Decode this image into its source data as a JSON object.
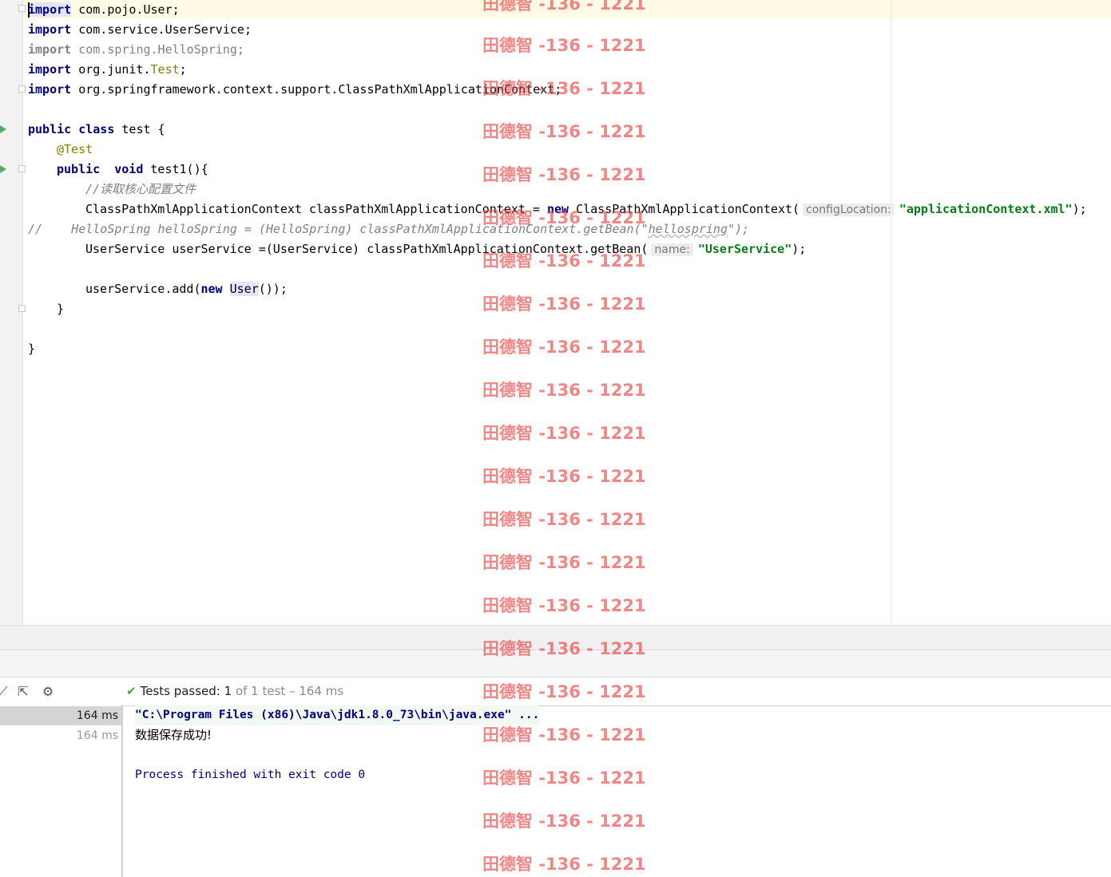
{
  "editor": {
    "imports": [
      {
        "keyword": "import",
        "path": "com.pojo.User",
        "suffix": ";"
      },
      {
        "keyword": "import",
        "path": "com.service.UserService",
        "suffix": ";"
      },
      {
        "keyword": "import",
        "path": "com.spring.HelloSpring",
        "suffix": ";"
      },
      {
        "keyword": "import",
        "path_a": "org.junit.",
        "path_b": "Test",
        "suffix": ";"
      },
      {
        "keyword": "import",
        "path": "org.springframework.context.support.ClassPathXmlApplicationContext",
        "suffix": ";"
      }
    ],
    "class_decl": {
      "kw1": "public",
      "kw2": "class",
      "name": "test {"
    },
    "annotation": "@Test",
    "method_decl": {
      "kw1": "public",
      "kw2": "void",
      "name": "test1(){"
    },
    "comment": "//读取核心配置文件",
    "line_ctx": {
      "a": "ClassPathXmlApplicationContext classPathXmlApplicationContext = ",
      "kw": "new",
      "b": " ClassPathXmlApplicationContext(",
      "hint": "configLocation:",
      "str": "\"applicationContext.xml\"",
      "c": ");"
    },
    "line_commented": {
      "prefix": "//",
      "a": "HelloSpring helloSpring = (HelloSpring) classPathXmlApplicationContext.getBean(\"",
      "b": "hellospring",
      "c": "\");"
    },
    "line_getbean": {
      "a": "UserService userService =(UserService) classPathXmlApplicationContext.getBean(",
      "hint": "name:",
      "str": "\"UserService\"",
      "c": ");"
    },
    "line_add": {
      "a": "userService.add(",
      "kw": "new",
      "sp": " ",
      "b": "User",
      "c": "());"
    },
    "close_method": "}",
    "close_class": "}"
  },
  "run_panel": {
    "status": {
      "label": "Tests passed: ",
      "passed": "1",
      "of": " of 1 test",
      "time": " – 164 ms"
    },
    "timings": [
      "164 ms",
      "164 ms"
    ],
    "console": {
      "command": "\"C:\\Program Files (x86)\\Java\\jdk1.8.0_73\\bin\\java.exe\" ...",
      "output": "数据保存成功!",
      "exit": "Process finished with exit code 0"
    }
  },
  "watermark": "田德智 -136 - 1221",
  "colors": {
    "keyword": "#000080",
    "string": "#067d17",
    "annotation": "#808000",
    "comment": "#808080",
    "pass": "#4ca34c",
    "watermark": "#e83c3c"
  }
}
